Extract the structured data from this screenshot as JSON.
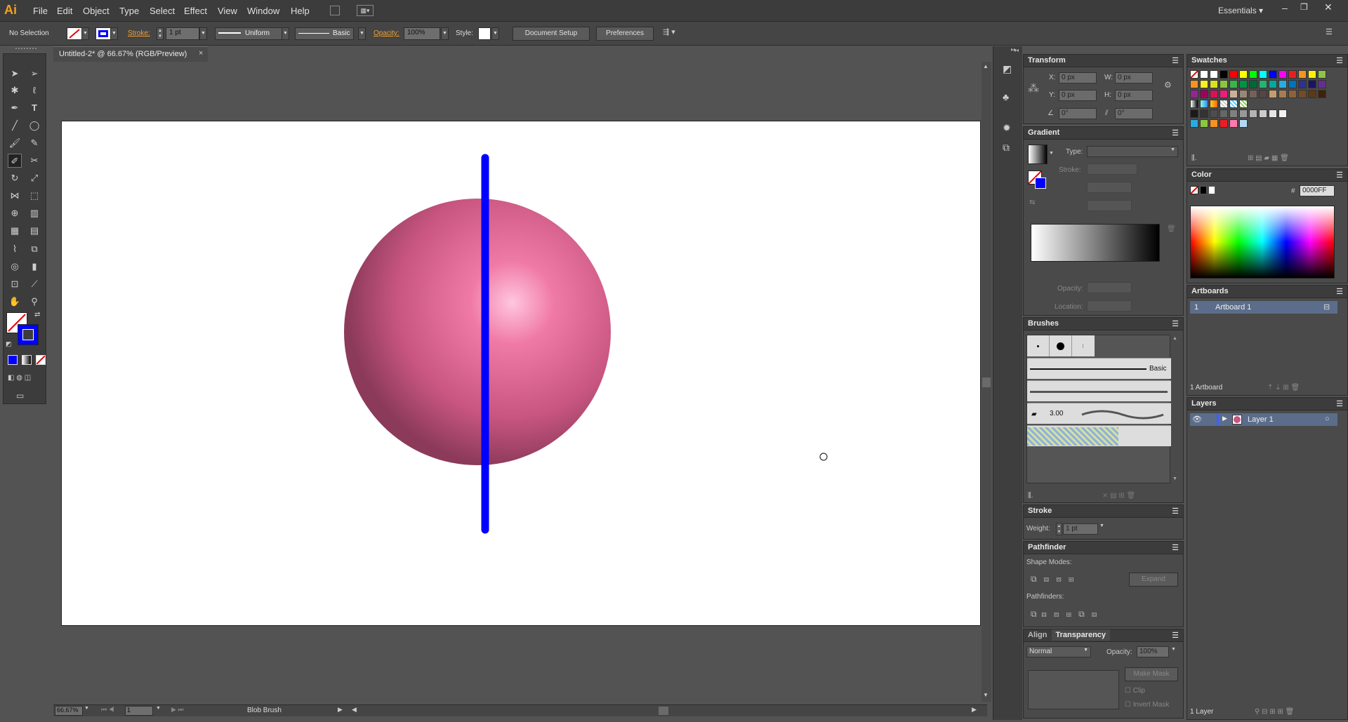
{
  "app": {
    "logo": "Ai",
    "workspace": "Essentials"
  },
  "menu": [
    "File",
    "Edit",
    "Object",
    "Type",
    "Select",
    "Effect",
    "View",
    "Window",
    "Help"
  ],
  "control": {
    "selection": "No Selection",
    "stroke_label": "Stroke:",
    "stroke_weight": "1 pt",
    "profile": "Uniform",
    "brush": "Basic",
    "opacity_label": "Opacity:",
    "opacity": "100%",
    "style_label": "Style:",
    "doc_setup": "Document Setup",
    "preferences": "Preferences"
  },
  "document": {
    "tab": "Untitled-2* @ 66.67% (RGB/Preview)"
  },
  "status": {
    "zoom": "66.67%",
    "artboard_num": "1",
    "tool": "Blob Brush"
  },
  "transform": {
    "title": "Transform",
    "x_label": "X:",
    "x": "0 px",
    "y_label": "Y:",
    "y": "0 px",
    "w_label": "W:",
    "w": "0 px",
    "h_label": "H:",
    "h": "0 px",
    "rot": "0°",
    "shear": "0°"
  },
  "gradient": {
    "title": "Gradient",
    "type_label": "Type:",
    "stroke_label": "Stroke:",
    "opacity_label": "Opacity:",
    "location_label": "Location:"
  },
  "brushes": {
    "title": "Brushes",
    "basic": "Basic",
    "size": "3.00"
  },
  "stroke": {
    "title": "Stroke",
    "weight_label": "Weight:",
    "weight": "1 pt"
  },
  "pathfinder": {
    "title": "Pathfinder",
    "shape_modes": "Shape Modes:",
    "pathfinders": "Pathfinders:",
    "expand": "Expand"
  },
  "transparency": {
    "tab_align": "Align",
    "tab_transparency": "Transparency",
    "mode": "Normal",
    "opacity_label": "Opacity:",
    "opacity": "100%",
    "make_mask": "Make Mask",
    "clip": "Clip",
    "invert": "Invert Mask"
  },
  "swatches": {
    "title": "Swatches",
    "row1": [
      "#ffffff",
      "#000000",
      "#ff0000",
      "#ffff00",
      "#00ff00",
      "#00ffff",
      "#0000ff",
      "#ff00ff",
      "#ed1c24",
      "#f7941d",
      "#fff200",
      "#8dc63f"
    ],
    "row2": [
      "#f7931e",
      "#fcee21",
      "#d9e021",
      "#8cc63f",
      "#39b54a",
      "#009245",
      "#006837",
      "#22b573",
      "#00a99d",
      "#29abe2",
      "#0071bc",
      "#2e3192",
      "#1b1464",
      "#662d91"
    ],
    "row3": [
      "#93278f",
      "#9e005d",
      "#d4145a",
      "#ed1e79",
      "#c7b299",
      "#998675",
      "#736357",
      "#534741",
      "#c69c6d",
      "#a67c52",
      "#8c6239",
      "#754c24",
      "#603813",
      "#42210b"
    ],
    "row5": [
      "#1a1a1a",
      "#333333",
      "#4d4d4d",
      "#666666",
      "#808080",
      "#999999",
      "#b3b3b3",
      "#cccccc",
      "#e6e6e6",
      "#f2f2f2"
    ],
    "row6": [
      "#29abe2",
      "#8cc63f",
      "#f7931e",
      "#ed1c24",
      "#ff7bac",
      "#b3d9f2"
    ]
  },
  "color": {
    "title": "Color",
    "hex_label": "#",
    "hex": "0000FF"
  },
  "artboards": {
    "title": "Artboards",
    "num": "1",
    "name": "Artboard 1",
    "count": "1 Artboard"
  },
  "layers": {
    "title": "Layers",
    "name": "Layer 1",
    "count": "1 Layer"
  }
}
